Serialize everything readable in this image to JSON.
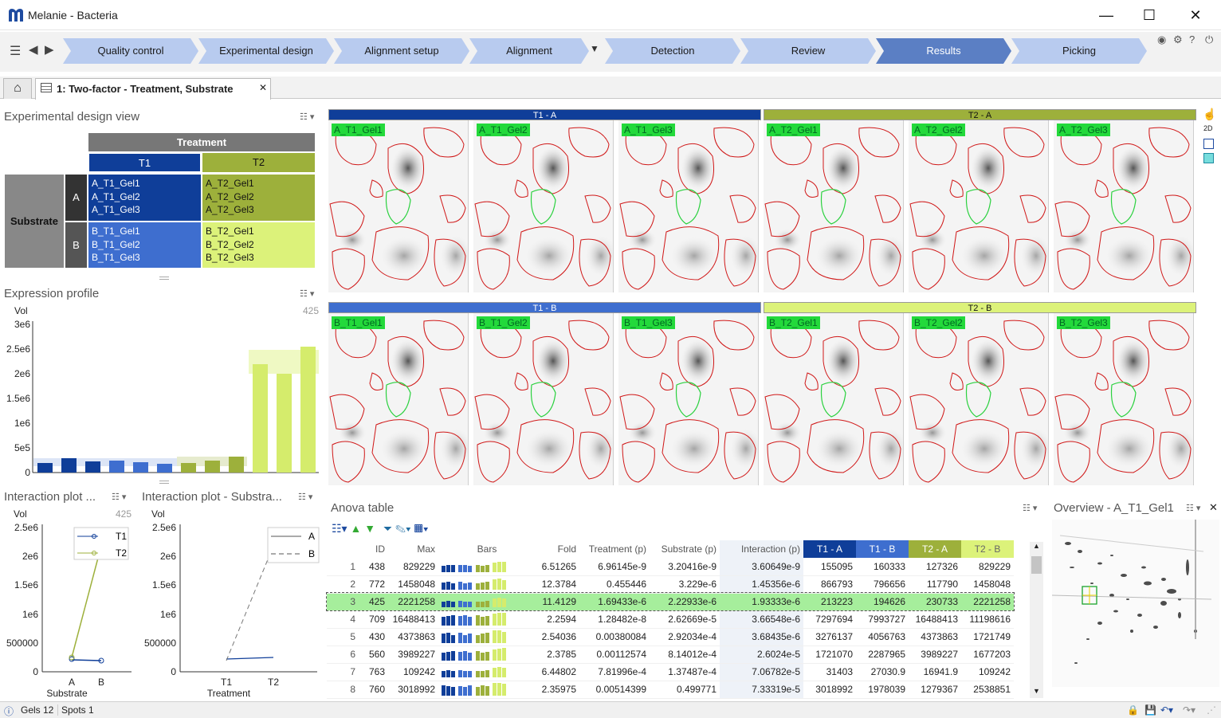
{
  "window": {
    "title": "Melanie - Bacteria",
    "minimize": "—",
    "maximize": "☐",
    "close": "✕"
  },
  "workflow": {
    "steps": [
      {
        "label": "Quality control",
        "active": false
      },
      {
        "label": "Experimental design",
        "active": false
      },
      {
        "label": "Alignment setup",
        "active": false
      },
      {
        "label": "Alignment",
        "active": false
      },
      {
        "label": "Detection",
        "active": false
      },
      {
        "label": "Review",
        "active": false
      },
      {
        "label": "Results",
        "active": true
      },
      {
        "label": "Picking",
        "active": false
      }
    ]
  },
  "tabs": {
    "home_icon": "home-icon",
    "active_tab": "1: Two-factor - Treatment, Substrate",
    "close": "✕"
  },
  "design_view": {
    "title": "Experimental design view",
    "factor1": "Treatment",
    "factor2": "Substrate",
    "levels1": [
      "T1",
      "T2"
    ],
    "levels2": [
      "A",
      "B"
    ],
    "cells": {
      "A_T1": [
        "A_T1_Gel1",
        "A_T1_Gel2",
        "A_T1_Gel3"
      ],
      "A_T2": [
        "A_T2_Gel1",
        "A_T2_Gel2",
        "A_T2_Gel3"
      ],
      "B_T1": [
        "B_T1_Gel1",
        "B_T1_Gel2",
        "B_T1_Gel3"
      ],
      "B_T2": [
        "B_T2_Gel1",
        "B_T2_Gel2",
        "B_T2_Gel3"
      ]
    },
    "colors": {
      "T1_A": "#0f3e99",
      "T1_B": "#3e6ecf",
      "T2_A": "#9db03b",
      "T2_B": "#dcf27a"
    }
  },
  "expression_profile": {
    "title": "Expression profile",
    "spot_id": "425",
    "ylabel": "Vol",
    "yticks": [
      "3e6",
      "2.5e6",
      "2e6",
      "1.5e6",
      "1e6",
      "5e5",
      "0"
    ]
  },
  "interaction_plot_1": {
    "title": "Interaction plot ...",
    "spot_id": "425",
    "ylabel": "Vol",
    "xlabel": "Substrate",
    "xticks": [
      "A",
      "B"
    ],
    "yticks": [
      "2.5e6",
      "2e6",
      "1.5e6",
      "1e6",
      "500000",
      "0"
    ],
    "legend": [
      "T1",
      "T2"
    ]
  },
  "interaction_plot_2": {
    "title": "Interaction plot - Substra...",
    "ylabel": "Vol",
    "xlabel": "Treatment",
    "xticks": [
      "T1",
      "T2"
    ],
    "yticks": [
      "2.5e6",
      "2e6",
      "1.5e6",
      "1e6",
      "500000",
      "0"
    ],
    "legend": [
      "A",
      "B"
    ]
  },
  "gel_groups": [
    {
      "label": "T1 - A",
      "gels": [
        "A_T1_Gel1",
        "A_T1_Gel2",
        "A_T1_Gel3"
      ]
    },
    {
      "label": "T2 - A",
      "gels": [
        "A_T2_Gel1",
        "A_T2_Gel2",
        "A_T2_Gel3"
      ]
    },
    {
      "label": "T1 - B",
      "gels": [
        "B_T1_Gel1",
        "B_T1_Gel2",
        "B_T1_Gel3"
      ]
    },
    {
      "label": "T2 - B",
      "gels": [
        "B_T2_Gel1",
        "B_T2_Gel2",
        "B_T2_Gel3"
      ]
    }
  ],
  "anova": {
    "title": "Anova table",
    "columns": [
      "ID",
      "Max",
      "Bars",
      "Fold",
      "Treatment (p)",
      "Substrate (p)",
      "Interaction (p)",
      "T1 - A",
      "T1 - B",
      "T2 - A",
      "T2 - B"
    ],
    "rows": [
      [
        "1",
        "438",
        "829229",
        "6.51265",
        "6.96145e-9",
        "3.20416e-9",
        "3.60649e-9",
        "155095",
        "160333",
        "127326",
        "829229"
      ],
      [
        "2",
        "772",
        "1458048",
        "12.3784",
        "0.455446",
        "3.229e-6",
        "1.45356e-6",
        "866793",
        "796656",
        "117790",
        "1458048"
      ],
      [
        "3",
        "425",
        "2221258",
        "11.4129",
        "1.69433e-6",
        "2.22933e-6",
        "1.93333e-6",
        "213223",
        "194626",
        "230733",
        "2221258"
      ],
      [
        "4",
        "709",
        "16488413",
        "2.2594",
        "1.28482e-8",
        "2.62669e-5",
        "3.66548e-6",
        "7297694",
        "7993727",
        "16488413",
        "11198616"
      ],
      [
        "5",
        "430",
        "4373863",
        "2.54036",
        "0.00380084",
        "2.92034e-4",
        "3.68435e-6",
        "3276137",
        "4056763",
        "4373863",
        "1721749"
      ],
      [
        "6",
        "560",
        "3989227",
        "2.3785",
        "0.00112574",
        "8.14012e-4",
        "2.6024e-5",
        "1721070",
        "2287965",
        "3989227",
        "1677203"
      ],
      [
        "7",
        "763",
        "109242",
        "6.44802",
        "7.81996e-4",
        "1.37487e-4",
        "7.06782e-5",
        "31403",
        "27030.9",
        "16941.9",
        "109242"
      ],
      [
        "8",
        "760",
        "3018992",
        "2.35975",
        "0.00514399",
        "0.499771",
        "7.33319e-5",
        "3018992",
        "1978039",
        "1279367",
        "2538851"
      ]
    ],
    "selected_row": 2
  },
  "overview": {
    "title": "Overview - A_T1_Gel1"
  },
  "status": {
    "gels": "Gels 12",
    "spots": "Spots 1"
  }
}
